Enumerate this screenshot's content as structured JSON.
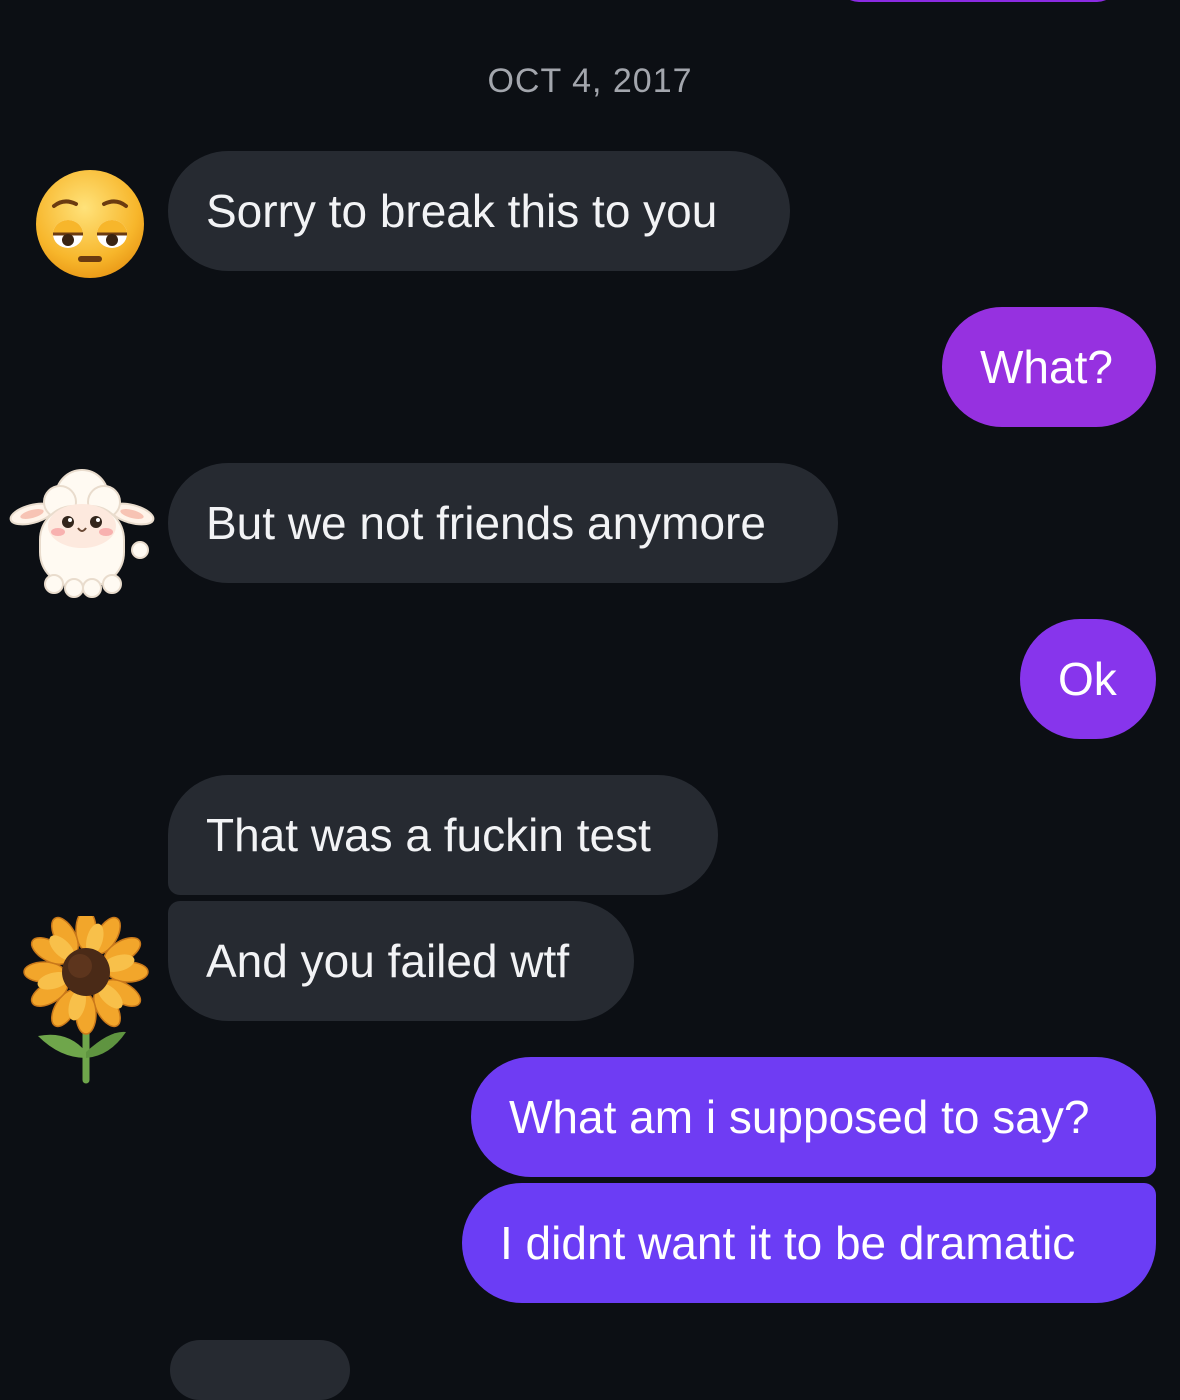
{
  "thread": {
    "date_separator": "OCT 4, 2017"
  },
  "messages": [
    {
      "side": "incoming",
      "text": "Sorry to break this to you",
      "avatar": "pleading-face-emoji"
    },
    {
      "side": "outgoing",
      "text": "What?"
    },
    {
      "side": "incoming",
      "text": "But we not friends anymore",
      "avatar": "sheep-sticker"
    },
    {
      "side": "outgoing",
      "text": "Ok"
    },
    {
      "side": "incoming",
      "text": "That was a fuckin test"
    },
    {
      "side": "incoming",
      "text": "And you failed wtf",
      "avatar": "sunflower-emoji"
    },
    {
      "side": "outgoing",
      "text": "What am i supposed to say?"
    },
    {
      "side": "outgoing",
      "text": "I didnt want it to be dramatic"
    }
  ],
  "colors": {
    "background": "#0c0f14",
    "incoming_bubble": "#262a31",
    "outgoing_gradient_top": "#9a2fe0",
    "outgoing_gradient_bottom": "#6a3cf6"
  }
}
